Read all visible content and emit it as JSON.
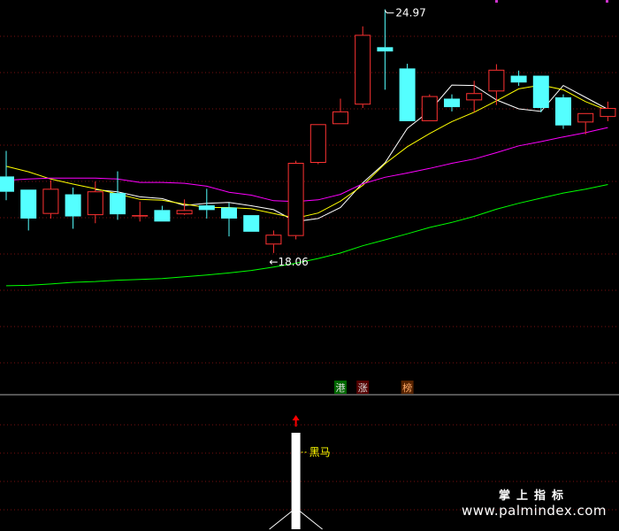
{
  "chart_data": {
    "type": "candlestick",
    "price_range": [
      16.24,
      25.19
    ],
    "candles": [
      {
        "open": 21.04,
        "high": 21.64,
        "low": 20.48,
        "close": 20.68
      },
      {
        "open": 20.73,
        "high": 20.73,
        "low": 19.77,
        "close": 20.05
      },
      {
        "open": 20.16,
        "high": 20.95,
        "low": 20.05,
        "close": 20.75
      },
      {
        "open": 20.62,
        "high": 20.78,
        "low": 19.81,
        "close": 20.1
      },
      {
        "open": 20.13,
        "high": 20.92,
        "low": 19.94,
        "close": 20.69
      },
      {
        "open": 20.65,
        "high": 21.16,
        "low": 20.02,
        "close": 20.15
      },
      {
        "open": 20.13,
        "high": 20.45,
        "low": 19.98,
        "close": 20.13
      },
      {
        "open": 20.25,
        "high": 20.35,
        "low": 19.98,
        "close": 19.98
      },
      {
        "open": 20.15,
        "high": 20.5,
        "low": 20.13,
        "close": 20.25
      },
      {
        "open": 20.36,
        "high": 20.75,
        "low": 20.05,
        "close": 20.25
      },
      {
        "open": 20.31,
        "high": 20.42,
        "low": 19.63,
        "close": 20.05
      },
      {
        "open": 20.13,
        "high": 20.13,
        "low": 19.74,
        "close": 19.74
      },
      {
        "open": 19.44,
        "high": 19.77,
        "low": 19.24,
        "close": 19.67
      },
      {
        "open": 19.64,
        "high": 21.41,
        "low": 19.56,
        "close": 21.36
      },
      {
        "open": 21.36,
        "high": 22.27,
        "low": 21.33,
        "close": 22.27
      },
      {
        "open": 22.27,
        "high": 22.87,
        "low": 22.27,
        "close": 22.57
      },
      {
        "open": 22.73,
        "high": 24.57,
        "low": 22.65,
        "close": 24.37
      },
      {
        "open": 24.08,
        "high": 24.97,
        "low": 23.08,
        "close": 23.98
      },
      {
        "open": 23.58,
        "high": 23.69,
        "low": 22.34,
        "close": 22.34
      },
      {
        "open": 22.34,
        "high": 22.97,
        "low": 22.34,
        "close": 22.93
      },
      {
        "open": 22.87,
        "high": 22.97,
        "low": 22.57,
        "close": 22.67
      },
      {
        "open": 22.83,
        "high": 23.29,
        "low": 22.55,
        "close": 23.0
      },
      {
        "open": 23.04,
        "high": 23.68,
        "low": 22.72,
        "close": 23.55
      },
      {
        "open": 23.41,
        "high": 23.53,
        "low": 23.17,
        "close": 23.25
      },
      {
        "open": 23.41,
        "high": 23.41,
        "low": 22.55,
        "close": 22.65
      },
      {
        "open": 22.9,
        "high": 22.97,
        "low": 22.16,
        "close": 22.24
      },
      {
        "open": 22.31,
        "high": 22.53,
        "low": 22.03,
        "close": 22.53
      },
      {
        "open": 22.44,
        "high": 22.8,
        "low": 22.34,
        "close": 22.65
      }
    ],
    "moving_averages": [
      {
        "color": "#ffffff",
        "values": [
          null,
          null,
          null,
          null,
          20.73,
          20.68,
          20.56,
          20.52,
          20.36,
          20.41,
          20.43,
          20.35,
          20.26,
          19.98,
          20.05,
          20.31,
          20.89,
          21.36,
          22.17,
          22.58,
          23.19,
          23.18,
          22.84,
          22.63,
          22.57,
          23.18,
          22.9,
          22.62
        ]
      },
      {
        "color": "#ffff00",
        "values": [
          21.28,
          21.15,
          20.98,
          20.86,
          20.75,
          20.63,
          20.5,
          20.48,
          20.39,
          20.31,
          20.31,
          20.28,
          20.17,
          20.06,
          20.18,
          20.46,
          20.83,
          21.34,
          21.74,
          22.05,
          22.33,
          22.55,
          22.82,
          23.1,
          23.19,
          23.08,
          22.8,
          22.59
        ]
      },
      {
        "color": "#ff00ff",
        "values": [
          20.95,
          20.98,
          21.0,
          21.0,
          21.0,
          20.98,
          20.9,
          20.9,
          20.88,
          20.81,
          20.67,
          20.6,
          20.47,
          20.45,
          20.49,
          20.62,
          20.87,
          21.02,
          21.12,
          21.23,
          21.35,
          21.45,
          21.6,
          21.76,
          21.86,
          21.97,
          22.07,
          22.19
        ]
      },
      {
        "color": "#00ff00",
        "values": [
          18.47,
          18.48,
          18.51,
          18.55,
          18.57,
          18.6,
          18.62,
          18.64,
          18.68,
          18.72,
          18.77,
          18.83,
          18.91,
          19.0,
          19.11,
          19.24,
          19.41,
          19.55,
          19.69,
          19.84,
          19.96,
          20.1,
          20.27,
          20.41,
          20.53,
          20.65,
          20.74,
          20.85
        ]
      }
    ],
    "annotations": {
      "high_label": "24.97",
      "low_label": "←18.06"
    },
    "badges": [
      {
        "text": "港",
        "candle": 15,
        "bg": "#006600",
        "color": "#dddddd"
      },
      {
        "text": "涨",
        "candle": 16,
        "bg": "#550000",
        "color": "#dddddd"
      },
      {
        "text": "榜",
        "candle": 18,
        "bg": "#552200",
        "color": "#ffaa66"
      }
    ],
    "indicator": {
      "label": "黑马",
      "label_color": "#ffff00",
      "bar_candle": 13,
      "bar_color": "#ffffff",
      "arrow_color": "#ff0000"
    }
  },
  "watermark": {
    "chinese": "掌上指标",
    "url": "www.palmindex.com"
  }
}
